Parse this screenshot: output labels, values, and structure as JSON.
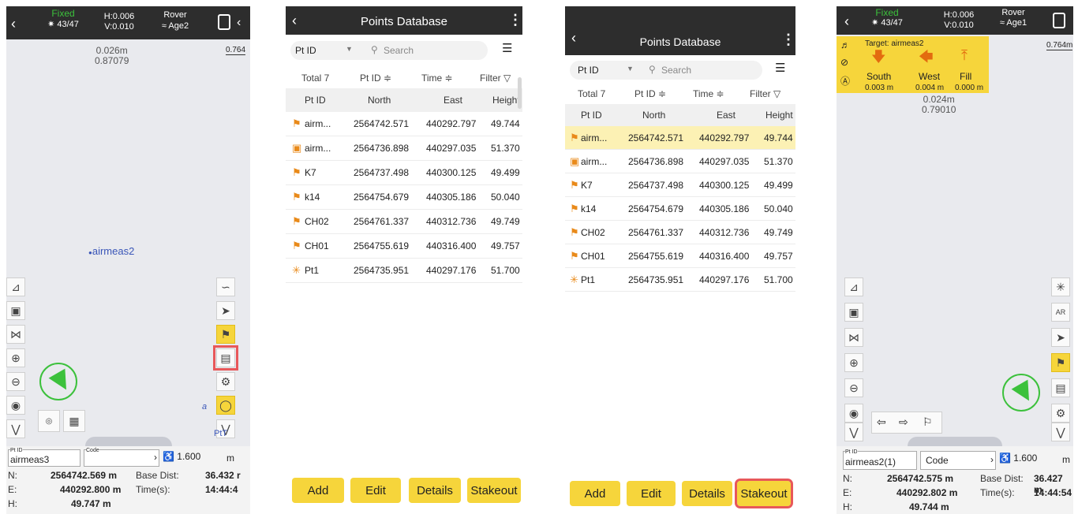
{
  "panel1": {
    "status": {
      "fix": "Fixed",
      "sats": "43/47",
      "h_prec": "H:0.006",
      "v_prec": "V:0.010",
      "mode": "Rover",
      "link": "Age2"
    },
    "readout": {
      "dist": "0.026m",
      "value": "0.87079",
      "scale": "0.764"
    },
    "map_point": "airmeas2",
    "bottom": {
      "pt_id_label": "Pt ID",
      "pt_id": "airmeas3",
      "code_label": "Code",
      "antenna_height": "1.600",
      "unit": "m",
      "n_label": "N:",
      "n_value": "2564742.569 m",
      "base_dist_label": "Base Dist:",
      "base_dist": "36.432 r",
      "e_label": "E:",
      "e_value": "440292.800 m",
      "time_label": "Time(s):",
      "time": "14:44:4",
      "h_label": "H:",
      "h_value": "49.747 m"
    },
    "edge_labels": {
      "a": "a",
      "pt": "PtT"
    }
  },
  "panel2": {
    "title": "Points Database",
    "filter_field": "Pt ID",
    "search_placeholder": "Search",
    "total": "Total 7",
    "sort_ptid": "Pt ID ≑",
    "sort_time": "Time ≑",
    "filter": "Filter ▽",
    "columns": [
      "Pt ID",
      "North",
      "East",
      "Height"
    ],
    "rows": [
      {
        "icon": "rod",
        "id": "airm...",
        "north": "2564742.571",
        "east": "440292.797",
        "height": "49.744"
      },
      {
        "icon": "camera",
        "id": "airm...",
        "north": "2564736.898",
        "east": "440297.035",
        "height": "51.370"
      },
      {
        "icon": "rod",
        "id": "K7",
        "north": "2564737.498",
        "east": "440300.125",
        "height": "49.499"
      },
      {
        "icon": "rod",
        "id": "k14",
        "north": "2564754.679",
        "east": "440305.186",
        "height": "50.040"
      },
      {
        "icon": "rod",
        "id": "CH02",
        "north": "2564761.337",
        "east": "440312.736",
        "height": "49.749"
      },
      {
        "icon": "rod",
        "id": "CH01",
        "north": "2564755.619",
        "east": "440316.400",
        "height": "49.757"
      },
      {
        "icon": "star",
        "id": "Pt1",
        "north": "2564735.951",
        "east": "440297.176",
        "height": "51.700"
      }
    ],
    "buttons": [
      "Add",
      "Edit",
      "Details",
      "Stakeout"
    ]
  },
  "panel4": {
    "status": {
      "fix": "Fixed",
      "sats": "43/47",
      "h_prec": "H:0.006",
      "v_prec": "V:0.010",
      "mode": "Rover",
      "link": "Age1"
    },
    "target_label": "Target: airmeas2",
    "directions": [
      {
        "label": "South",
        "value": "0.003 m"
      },
      {
        "label": "West",
        "value": "0.004 m"
      },
      {
        "label": "Fill",
        "value": "0.000 m"
      }
    ],
    "scale": "0.764m",
    "readout": {
      "dist": "0.024m",
      "value": "0.79010"
    },
    "bottom": {
      "pt_id_label": "Pt ID",
      "pt_id": "airmeas2(1)",
      "code_label": "Code",
      "antenna_height": "1.600",
      "unit": "m",
      "n_label": "N:",
      "n_value": "2564742.575 m",
      "base_dist_label": "Base Dist:",
      "base_dist": "36.427 m",
      "e_label": "E:",
      "e_value": "440292.802 m",
      "time_label": "Time(s):",
      "time": "14:44:54",
      "h_label": "H:",
      "h_value": "49.744 m"
    }
  },
  "colors": {
    "accent_yellow": "#f6d53b",
    "highlight_red": "#e8585a",
    "fixed_green": "#3cc13c",
    "point_orange": "#e98a1a",
    "map_bg": "#e9eaee"
  }
}
